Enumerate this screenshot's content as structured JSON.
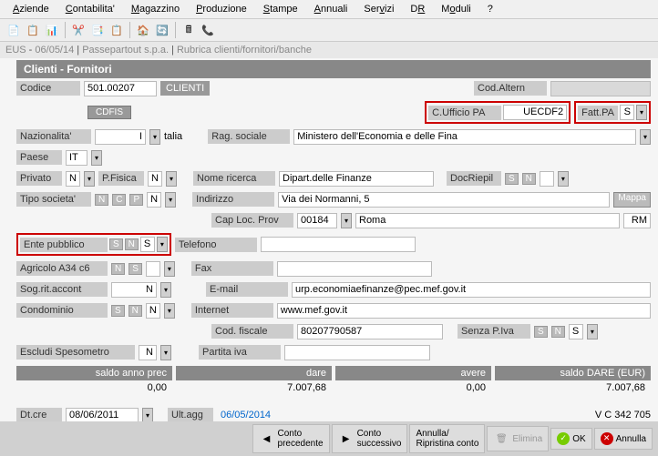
{
  "menu": {
    "items": [
      "Aziende",
      "Contabilita'",
      "Magazzino",
      "Produzione",
      "Stampe",
      "Annuali",
      "Servizi",
      "DR",
      "Moduli",
      "?"
    ]
  },
  "breadcrumb": {
    "env": "EUS",
    "date": "06/05/14",
    "company": "Passepartout s.p.a.",
    "path": "Rubrica clienti/fornitori/banche"
  },
  "win": {
    "title": "Clienti - Fornitori"
  },
  "form": {
    "codice_label": "Codice",
    "codice": "501.00207",
    "tipo": "CLIENTI",
    "cdfis_btn": "CDFIS",
    "codaltern_label": "Cod.Altern",
    "cufficio_label": "C.Ufficio PA",
    "cufficio": "UECDF2",
    "fattpa_label": "Fatt.PA",
    "fattpa_val": "S",
    "nazionalita_label": "Nazionalita'",
    "nazionalita": "Italia",
    "ragsociale_label": "Rag. sociale",
    "ragsociale": "Ministero dell'Economia e delle Fina",
    "paese_label": "Paese",
    "paese": "IT",
    "privato_label": "Privato",
    "privato": "N",
    "pfisica_label": "P.Fisica",
    "pfisica": "N",
    "nomericerca_label": "Nome ricerca",
    "nomericerca": "Dipart.delle Finanze",
    "docriepil_label": "DocRiepil",
    "tiposocieta_label": "Tipo societa'",
    "indirizzo_label": "Indirizzo",
    "indirizzo": "Via dei Normanni, 5",
    "mappa_btn": "Mappa",
    "caploc_label": "Cap Loc. Prov",
    "cap": "00184",
    "loc": "Roma",
    "prov": "RM",
    "entepubblico_label": "Ente pubblico",
    "entepubblico": "S",
    "telefono_label": "Telefono",
    "agricolo_label": "Agricolo A34 c6",
    "fax_label": "Fax",
    "sogrit_label": "Sog.rit.accont",
    "sogrit": "N",
    "email_label": "E-mail",
    "email": "urp.economiaefinanze@pec.mef.gov.it",
    "condominio_label": "Condominio",
    "condominio": "N",
    "internet_label": "Internet",
    "internet": "www.mef.gov.it",
    "codfiscale_label": "Cod. fiscale",
    "codfiscale": "80207790587",
    "senzapiva_label": "Senza P.Iva",
    "senzapiva": "S",
    "escludi_label": "Escludi Spesometro",
    "escludi": "N",
    "partitaiva_label": "Partita iva",
    "nc": "N",
    "c": "C",
    "p": "P",
    "s": "S",
    "n": "N"
  },
  "totals": {
    "h1": "saldo anno prec",
    "v1": "0,00",
    "h2": "dare",
    "v2": "7.007,68",
    "h3": "avere",
    "v3": "0,00",
    "h4": "saldo DARE (EUR)",
    "v4": "7.007,68"
  },
  "dates": {
    "dtcre_label": "Dt.cre",
    "dtcre": "08/06/2011",
    "ultagg_label": "Ult.agg",
    "ultagg": "06/05/2014",
    "vc": "V C 342 705"
  },
  "buttons": {
    "contoprec": "Conto\nprecedente",
    "contosucc": "Conto\nsuccessivo",
    "annripr": "Annulla/\nRipristina conto",
    "elimina": "Elimina",
    "ok": "OK",
    "annulla": "Annulla"
  }
}
